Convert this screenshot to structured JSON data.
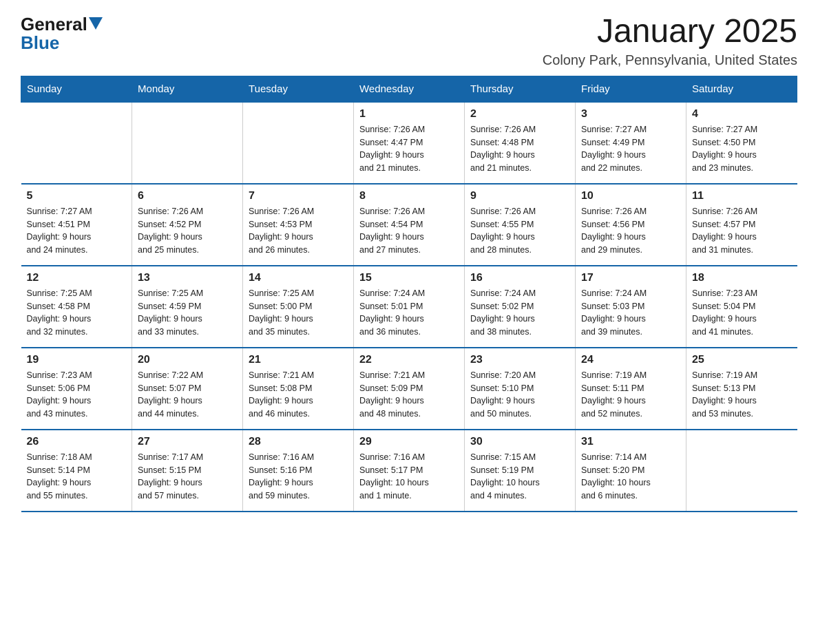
{
  "logo": {
    "general": "General",
    "blue": "Blue"
  },
  "title": "January 2025",
  "location": "Colony Park, Pennsylvania, United States",
  "days_of_week": [
    "Sunday",
    "Monday",
    "Tuesday",
    "Wednesday",
    "Thursday",
    "Friday",
    "Saturday"
  ],
  "weeks": [
    [
      {
        "day": "",
        "info": ""
      },
      {
        "day": "",
        "info": ""
      },
      {
        "day": "",
        "info": ""
      },
      {
        "day": "1",
        "info": "Sunrise: 7:26 AM\nSunset: 4:47 PM\nDaylight: 9 hours\nand 21 minutes."
      },
      {
        "day": "2",
        "info": "Sunrise: 7:26 AM\nSunset: 4:48 PM\nDaylight: 9 hours\nand 21 minutes."
      },
      {
        "day": "3",
        "info": "Sunrise: 7:27 AM\nSunset: 4:49 PM\nDaylight: 9 hours\nand 22 minutes."
      },
      {
        "day": "4",
        "info": "Sunrise: 7:27 AM\nSunset: 4:50 PM\nDaylight: 9 hours\nand 23 minutes."
      }
    ],
    [
      {
        "day": "5",
        "info": "Sunrise: 7:27 AM\nSunset: 4:51 PM\nDaylight: 9 hours\nand 24 minutes."
      },
      {
        "day": "6",
        "info": "Sunrise: 7:26 AM\nSunset: 4:52 PM\nDaylight: 9 hours\nand 25 minutes."
      },
      {
        "day": "7",
        "info": "Sunrise: 7:26 AM\nSunset: 4:53 PM\nDaylight: 9 hours\nand 26 minutes."
      },
      {
        "day": "8",
        "info": "Sunrise: 7:26 AM\nSunset: 4:54 PM\nDaylight: 9 hours\nand 27 minutes."
      },
      {
        "day": "9",
        "info": "Sunrise: 7:26 AM\nSunset: 4:55 PM\nDaylight: 9 hours\nand 28 minutes."
      },
      {
        "day": "10",
        "info": "Sunrise: 7:26 AM\nSunset: 4:56 PM\nDaylight: 9 hours\nand 29 minutes."
      },
      {
        "day": "11",
        "info": "Sunrise: 7:26 AM\nSunset: 4:57 PM\nDaylight: 9 hours\nand 31 minutes."
      }
    ],
    [
      {
        "day": "12",
        "info": "Sunrise: 7:25 AM\nSunset: 4:58 PM\nDaylight: 9 hours\nand 32 minutes."
      },
      {
        "day": "13",
        "info": "Sunrise: 7:25 AM\nSunset: 4:59 PM\nDaylight: 9 hours\nand 33 minutes."
      },
      {
        "day": "14",
        "info": "Sunrise: 7:25 AM\nSunset: 5:00 PM\nDaylight: 9 hours\nand 35 minutes."
      },
      {
        "day": "15",
        "info": "Sunrise: 7:24 AM\nSunset: 5:01 PM\nDaylight: 9 hours\nand 36 minutes."
      },
      {
        "day": "16",
        "info": "Sunrise: 7:24 AM\nSunset: 5:02 PM\nDaylight: 9 hours\nand 38 minutes."
      },
      {
        "day": "17",
        "info": "Sunrise: 7:24 AM\nSunset: 5:03 PM\nDaylight: 9 hours\nand 39 minutes."
      },
      {
        "day": "18",
        "info": "Sunrise: 7:23 AM\nSunset: 5:04 PM\nDaylight: 9 hours\nand 41 minutes."
      }
    ],
    [
      {
        "day": "19",
        "info": "Sunrise: 7:23 AM\nSunset: 5:06 PM\nDaylight: 9 hours\nand 43 minutes."
      },
      {
        "day": "20",
        "info": "Sunrise: 7:22 AM\nSunset: 5:07 PM\nDaylight: 9 hours\nand 44 minutes."
      },
      {
        "day": "21",
        "info": "Sunrise: 7:21 AM\nSunset: 5:08 PM\nDaylight: 9 hours\nand 46 minutes."
      },
      {
        "day": "22",
        "info": "Sunrise: 7:21 AM\nSunset: 5:09 PM\nDaylight: 9 hours\nand 48 minutes."
      },
      {
        "day": "23",
        "info": "Sunrise: 7:20 AM\nSunset: 5:10 PM\nDaylight: 9 hours\nand 50 minutes."
      },
      {
        "day": "24",
        "info": "Sunrise: 7:19 AM\nSunset: 5:11 PM\nDaylight: 9 hours\nand 52 minutes."
      },
      {
        "day": "25",
        "info": "Sunrise: 7:19 AM\nSunset: 5:13 PM\nDaylight: 9 hours\nand 53 minutes."
      }
    ],
    [
      {
        "day": "26",
        "info": "Sunrise: 7:18 AM\nSunset: 5:14 PM\nDaylight: 9 hours\nand 55 minutes."
      },
      {
        "day": "27",
        "info": "Sunrise: 7:17 AM\nSunset: 5:15 PM\nDaylight: 9 hours\nand 57 minutes."
      },
      {
        "day": "28",
        "info": "Sunrise: 7:16 AM\nSunset: 5:16 PM\nDaylight: 9 hours\nand 59 minutes."
      },
      {
        "day": "29",
        "info": "Sunrise: 7:16 AM\nSunset: 5:17 PM\nDaylight: 10 hours\nand 1 minute."
      },
      {
        "day": "30",
        "info": "Sunrise: 7:15 AM\nSunset: 5:19 PM\nDaylight: 10 hours\nand 4 minutes."
      },
      {
        "day": "31",
        "info": "Sunrise: 7:14 AM\nSunset: 5:20 PM\nDaylight: 10 hours\nand 6 minutes."
      },
      {
        "day": "",
        "info": ""
      }
    ]
  ]
}
